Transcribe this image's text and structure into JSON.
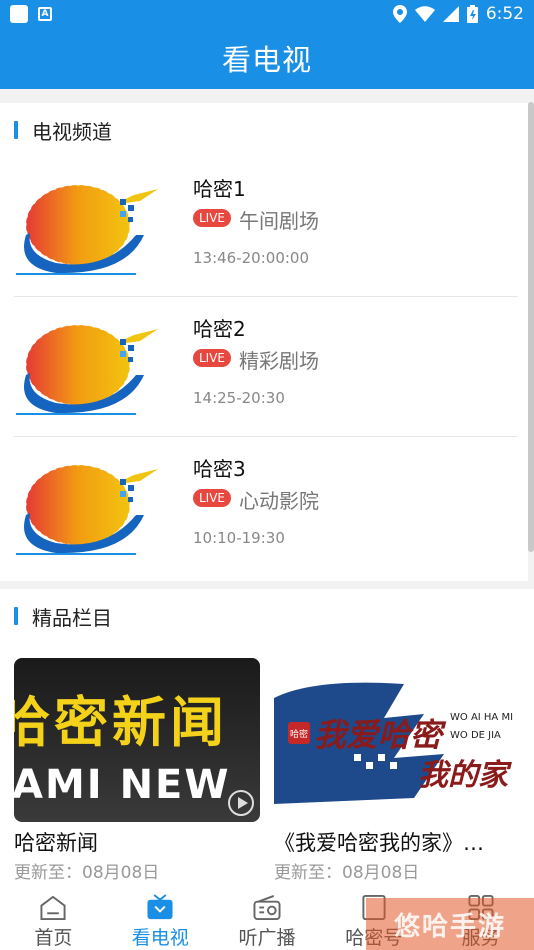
{
  "status_bar": {
    "time": "6:52",
    "icons": [
      "notification-square-icon",
      "a-icon",
      "location-icon",
      "wifi-icon",
      "signal-icon",
      "battery-icon"
    ]
  },
  "app_bar": {
    "title": "看电视"
  },
  "tv_channels": {
    "section_title": "电视频道",
    "items": [
      {
        "name": "哈密1",
        "live_label": "LIVE",
        "program": "午间剧场",
        "time": "13:46-20:00:00"
      },
      {
        "name": "哈密2",
        "live_label": "LIVE",
        "program": "精彩剧场",
        "time": "14:25-20:30"
      },
      {
        "name": "哈密3",
        "live_label": "LIVE",
        "program": "心动影院",
        "time": "10:10-19:30"
      }
    ]
  },
  "featured": {
    "section_title": "精品栏目",
    "items": [
      {
        "title": "哈密新闻",
        "update": "更新至：08月08日",
        "thumb_text_top": "哈密新闻",
        "thumb_text_bottom": "AMI NEW"
      },
      {
        "title": "《我爱哈密我的家》…",
        "update": "更新至：08月08日",
        "thumb_text_cn": "我爱哈密",
        "thumb_text_cn2": "我的家",
        "thumb_text_en1": "WO AI HA MI",
        "thumb_text_en2": "WO DE JIA",
        "thumb_seal": "哈密"
      }
    ]
  },
  "tab_bar": {
    "items": [
      {
        "label": "首页",
        "icon": "home-icon"
      },
      {
        "label": "看电视",
        "icon": "tv-icon",
        "active": true
      },
      {
        "label": "听广播",
        "icon": "radio-icon"
      },
      {
        "label": "哈密号",
        "icon": "account-icon"
      },
      {
        "label": "服务",
        "icon": "grid-icon"
      }
    ]
  },
  "watermark": {
    "text": "悠哈手游"
  },
  "colors": {
    "primary": "#1a8fe6",
    "live": "#e8473f"
  }
}
